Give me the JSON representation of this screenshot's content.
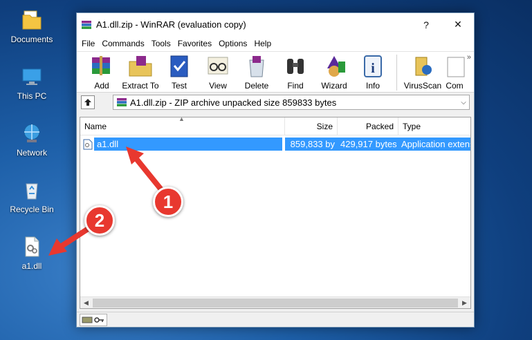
{
  "desktop": {
    "icons": [
      {
        "label": "Documents",
        "icon": "folder-icon"
      },
      {
        "label": "This PC",
        "icon": "computer-icon"
      },
      {
        "label": "Network",
        "icon": "network-icon"
      },
      {
        "label": "Recycle Bin",
        "icon": "recycle-bin-icon"
      },
      {
        "label": "a1.dll",
        "icon": "dll-file-icon"
      }
    ]
  },
  "window": {
    "title": "A1.dll.zip - WinRAR (evaluation copy)",
    "help_btn": "?",
    "close_btn": "✕"
  },
  "menu": [
    "File",
    "Commands",
    "Tools",
    "Favorites",
    "Options",
    "Help"
  ],
  "toolbar": {
    "tools": [
      "Add",
      "Extract To",
      "Test",
      "View",
      "Delete",
      "Find",
      "Wizard",
      "Info",
      "VirusScan",
      "Com"
    ],
    "more": "»"
  },
  "path": {
    "text": "A1.dll.zip - ZIP archive unpacked size 859833 bytes"
  },
  "columns": {
    "name": "Name",
    "size": "Size",
    "packed": "Packed",
    "type": "Type"
  },
  "files": [
    {
      "name": "a1.dll",
      "size": "859,833 by",
      "packed": "429,917 bytes",
      "type": "Application extens"
    }
  ],
  "annotations": {
    "badge1": "1",
    "badge2": "2",
    "color": "#e8382f"
  },
  "colors": {
    "selection": "#3399ff",
    "arrow": "#e8382f"
  }
}
